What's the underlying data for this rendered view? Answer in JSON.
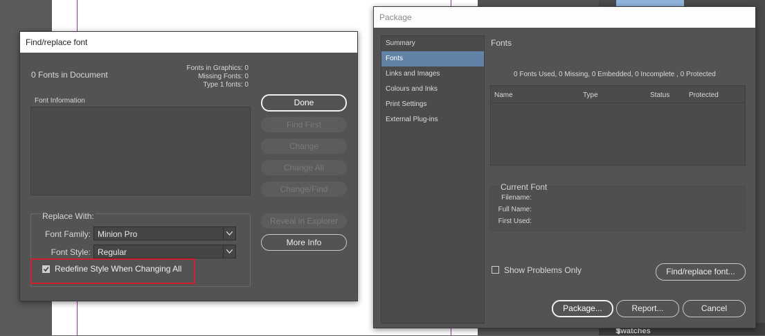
{
  "background": {
    "swatches_tab": "Swatches",
    "colors": {
      "guide": "#9d2fb0",
      "highlight": "#d21f2f",
      "selected": "#6283a6"
    }
  },
  "find_replace": {
    "title": "Find/replace font",
    "fonts_in_document": "0 Fonts in Document",
    "stats": {
      "graphics": "Fonts in Graphics: 0",
      "missing": "Missing Fonts: 0",
      "type1": "Type 1 fonts: 0"
    },
    "font_information_label": "Font Information",
    "buttons": {
      "done": "Done",
      "find_first": "Find First",
      "change": "Change",
      "change_all": "Change All",
      "change_find": "Change/Find",
      "reveal": "Reveal in Explorer",
      "more_info": "More Info"
    },
    "replace_with": {
      "label": "Replace With:",
      "font_family_label": "Font Family:",
      "font_family_value": "Minion Pro",
      "font_style_label": "Font Style:",
      "font_style_value": "Regular",
      "redefine_label": "Redefine Style When Changing All",
      "redefine_checked": true
    }
  },
  "package": {
    "title": "Package",
    "nav": [
      {
        "label": "Summary",
        "selected": false
      },
      {
        "label": "Fonts",
        "selected": true
      },
      {
        "label": "Links and Images",
        "selected": false
      },
      {
        "label": "Colours and Inks",
        "selected": false
      },
      {
        "label": "Print Settings",
        "selected": false
      },
      {
        "label": "External Plug-ins",
        "selected": false
      }
    ],
    "section_title": "Fonts",
    "summary": "0 Fonts Used, 0 Missing, 0 Embedded, 0 Incomplete , 0 Protected",
    "columns": [
      "Name",
      "Type",
      "Status",
      "Protected"
    ],
    "current_font": {
      "title": "Current Font",
      "filename": "Filename:",
      "full_name": "Full Name:",
      "first_used": "First Used:"
    },
    "show_problems_label": "Show Problems Only",
    "show_problems_checked": false,
    "buttons": {
      "find_replace": "Find/replace font...",
      "package": "Package...",
      "report": "Report...",
      "cancel": "Cancel"
    }
  }
}
